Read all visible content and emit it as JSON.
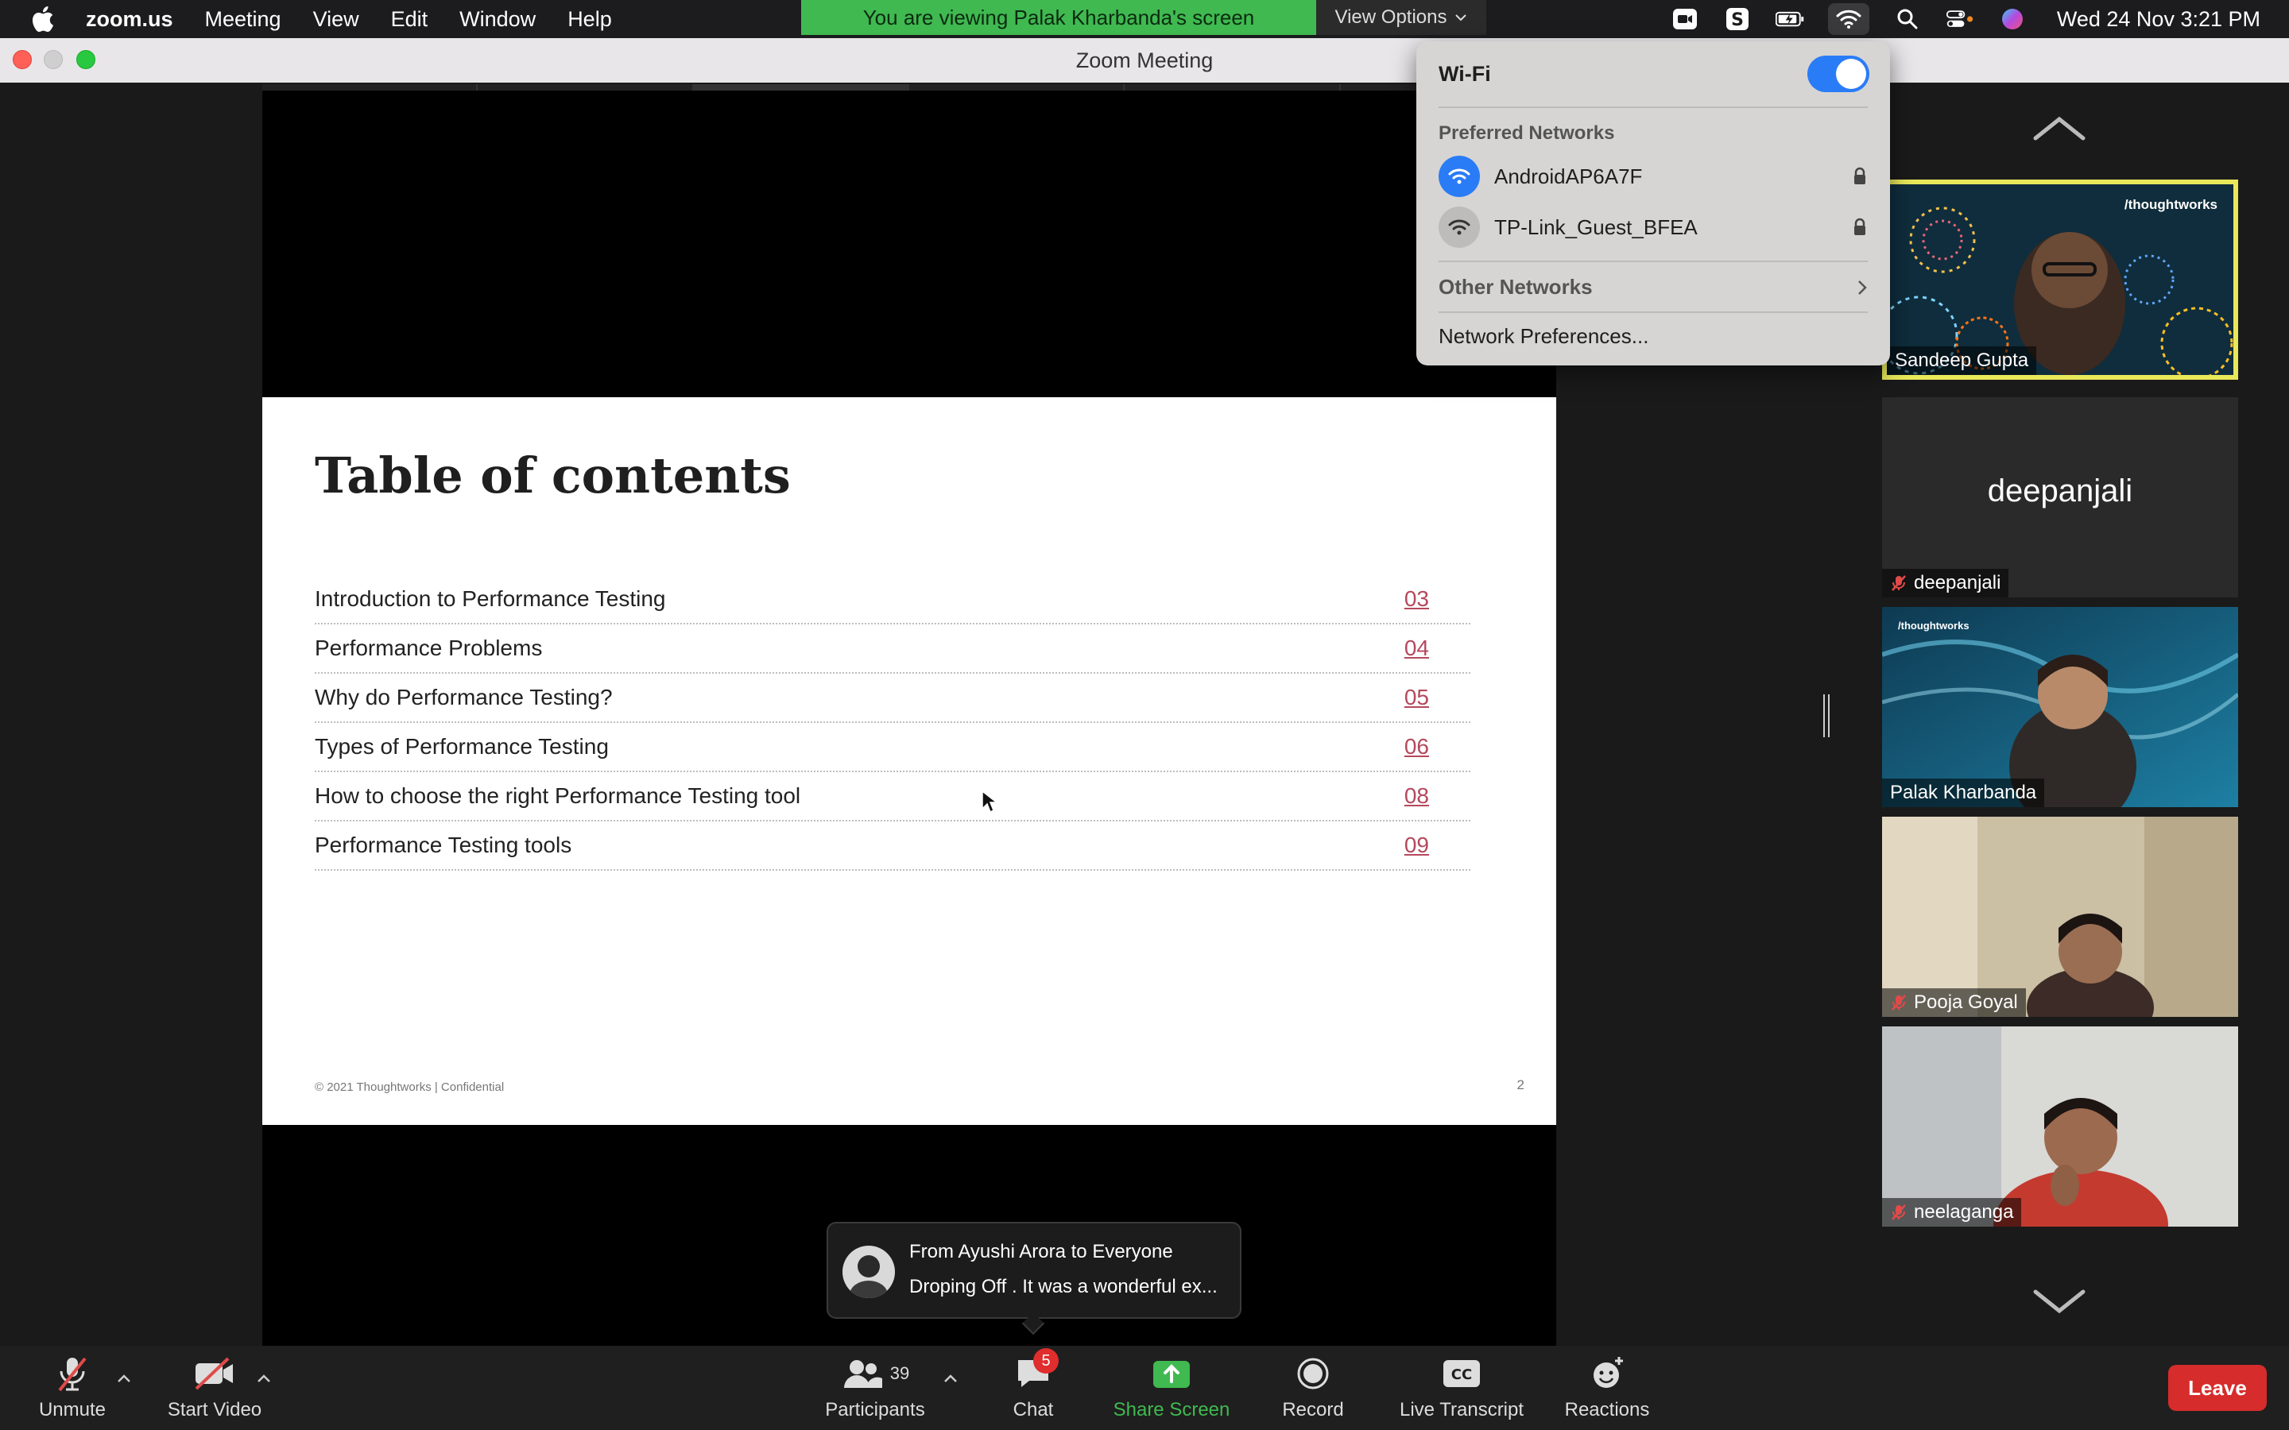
{
  "menubar": {
    "app_name": "zoom.us",
    "items": [
      "Meeting",
      "View",
      "Edit",
      "Window",
      "Help"
    ],
    "clock": "Wed 24 Nov  3:21 PM"
  },
  "banner": {
    "viewing_text": "You are viewing Palak Kharbanda's screen",
    "view_options": "View Options"
  },
  "window": {
    "title": "Zoom Meeting"
  },
  "slide": {
    "title": "Table of contents",
    "toc": [
      {
        "text": "Introduction to Performance Testing",
        "page": "03"
      },
      {
        "text": "Performance Problems",
        "page": "04"
      },
      {
        "text": "Why do Performance Testing?",
        "page": "05"
      },
      {
        "text": "Types of Performance Testing",
        "page": "06"
      },
      {
        "text": "How to choose the right Performance Testing tool",
        "page": "08"
      },
      {
        "text": "Performance Testing tools",
        "page": "09"
      }
    ],
    "footer": "© 2021 Thoughtworks  |  Confidential",
    "page_number": "2"
  },
  "wifi_menu": {
    "title": "Wi-Fi",
    "enabled": true,
    "preferred_heading": "Preferred Networks",
    "networks": [
      {
        "name": "AndroidAP6A7F",
        "connected": true
      },
      {
        "name": "TP-Link_Guest_BFEA",
        "connected": false
      }
    ],
    "other_networks": "Other Networks",
    "preferences": "Network Preferences..."
  },
  "participants": [
    {
      "name": "Sandeep Gupta",
      "muted": false,
      "active_speaker": true,
      "logo": "/thoughtworks"
    },
    {
      "name": "deepanjali",
      "muted": true,
      "video": false
    },
    {
      "name": "Palak Kharbanda",
      "muted": false,
      "logo": "/thoughtworks"
    },
    {
      "name": "Pooja Goyal",
      "muted": true
    },
    {
      "name": "neelaganga",
      "muted": true
    }
  ],
  "chat_toast": {
    "from": "From Ayushi Arora to Everyone",
    "message": "Droping Off . It was a wonderful ex..."
  },
  "toolbar": {
    "unmute": "Unmute",
    "start_video": "Start Video",
    "participants": "Participants",
    "participants_count": "39",
    "chat": "Chat",
    "chat_badge": "5",
    "share_screen": "Share Screen",
    "record": "Record",
    "live_transcript": "Live Transcript",
    "reactions": "Reactions",
    "leave": "Leave"
  },
  "colors": {
    "share_green": "#3fb950",
    "leave_red": "#d62c2c",
    "toc_link": "#b5485d",
    "wifi_blue": "#2a7cf6",
    "active_speaker_border": "#e8e85a"
  }
}
